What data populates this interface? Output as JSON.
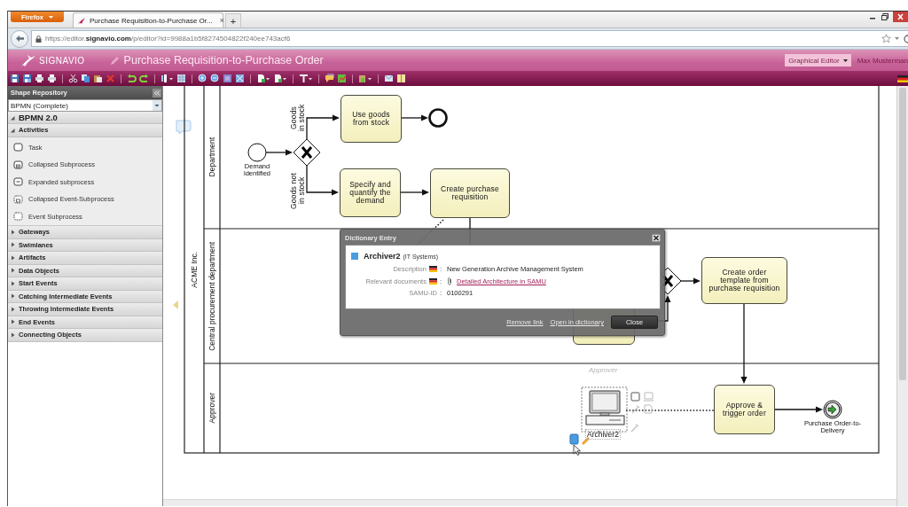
{
  "browser": {
    "menu_button": "Firefox",
    "tab": {
      "title": "Purchase Requisition-to-Purchase Or...",
      "close": "×"
    },
    "new_tab": "+",
    "url": "https://editor.**signavio.com**/p/editor?id=9988a1b5f8274504822f240ee743acf6"
  },
  "app_header": {
    "logo": "SIGNAVIO",
    "document_title": "Purchase Requisition-to-Purchase Order",
    "view_switch": "Graphical Editor",
    "user": "Max Musterman"
  },
  "sidebar": {
    "title": "Shape Repository",
    "stencil_set": "BPMN (Complete)",
    "sections": [
      {
        "label": "BPMN 2.0",
        "expanded": true,
        "children": [
          {
            "label": "Activities",
            "expanded": true,
            "children": [
              {
                "label": "Task",
                "kind": "task"
              },
              {
                "label": "Collapsed Subprocess",
                "kind": "collapsed-subprocess"
              },
              {
                "label": "Expanded subprocess",
                "kind": "expanded-subprocess"
              },
              {
                "label": "Collapsed Event-Subprocess",
                "kind": "collapsed-event-subprocess"
              },
              {
                "label": "Event Subprocess",
                "kind": "event-subprocess"
              }
            ]
          },
          {
            "label": "Gateways",
            "expanded": false
          },
          {
            "label": "Swimlanes",
            "expanded": false
          },
          {
            "label": "Artifacts",
            "expanded": false
          },
          {
            "label": "Data Objects",
            "expanded": false
          },
          {
            "label": "Start Events",
            "expanded": false
          },
          {
            "label": "Catching Intermediate Events",
            "expanded": false
          },
          {
            "label": "Throwing Intermediate Events",
            "expanded": false
          },
          {
            "label": "End Events",
            "expanded": false
          },
          {
            "label": "Connecting Objects",
            "expanded": false
          }
        ]
      }
    ]
  },
  "diagram": {
    "pool": "ACME Inc.",
    "lanes": [
      "Department",
      "Central procurement department",
      "Approver"
    ],
    "lane_hint": "Approver",
    "nodes": [
      {
        "kind": "start-event",
        "label": "Demand identified"
      },
      {
        "kind": "gateway"
      },
      {
        "kind": "task",
        "label": "Use goods from stock"
      },
      {
        "kind": "end-event"
      },
      {
        "kind": "task",
        "label": "Specify and quantify the demand"
      },
      {
        "kind": "task",
        "label": "Create purchase requisition"
      },
      {
        "kind": "gateway"
      },
      {
        "kind": "task"
      },
      {
        "kind": "task",
        "label": "Create order template from purchase requisition"
      },
      {
        "kind": "it-system",
        "label": "Archiver2",
        "selected": true
      },
      {
        "kind": "task",
        "label": "Approve & trigger order"
      },
      {
        "kind": "message-end-event",
        "label": "Purchase Order-to-Delivery"
      }
    ],
    "flows": [
      {
        "kind": "sequence"
      },
      {
        "kind": "sequence",
        "label": "Goods in stock"
      },
      {
        "kind": "sequence"
      },
      {
        "kind": "sequence",
        "label": "Goods not in stock"
      },
      {
        "kind": "sequence"
      },
      {
        "kind": "sequence"
      },
      {
        "kind": "association"
      },
      {
        "kind": "sequence"
      },
      {
        "kind": "sequence"
      },
      {
        "kind": "sequence"
      },
      {
        "kind": "association"
      },
      {
        "kind": "sequence"
      }
    ]
  },
  "dictionary_dialog": {
    "title": "Dictionary Entry",
    "name": "Archiver2",
    "category": "(IT Systems)",
    "fields": [
      {
        "label": "Description",
        "flag": true,
        "separator": ":",
        "kind": "text",
        "value": "New Generation Archive Management System"
      },
      {
        "label": "Relevant documents",
        "flag": true,
        "separator": ":",
        "kind": "link",
        "value": "Detailed Architecture in SAMU"
      },
      {
        "label": "SAMU-ID",
        "flag": false,
        "separator": ":",
        "kind": "text",
        "value": "0100291"
      }
    ],
    "links": [
      "Remove link",
      "Open in dictionary"
    ],
    "button": "Close"
  }
}
